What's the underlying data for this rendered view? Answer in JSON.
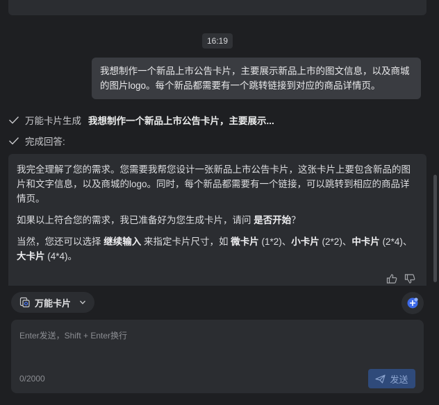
{
  "conversation": {
    "timestamp": "16:19",
    "user_message": "我想制作一个新品上市公告卡片，主要展示新品上市的图文信息，以及商城的图片logo。每个新品都需要有一个跳转链接到对应的商品详情页。",
    "steps": [
      {
        "tool": "万能卡片生成",
        "detail": "我想制作一个新品上市公告卡片，主要展示..."
      },
      {
        "tool": "完成回答:",
        "detail": ""
      }
    ],
    "answer": {
      "p1": "我完全理解了您的需求。您需要我帮您设计一张新品上市公告卡片，这张卡片上要包含新品的图片和文字信息，以及商城的logo。同时，每个新品都需要有一个链接，可以跳转到相应的商品详情页。",
      "p2_prefix": "如果以上符合您的需求，我已准备好为您生成卡片，请问 ",
      "p2_bold": "是否开始",
      "p2_suffix": "？",
      "p3_a": "当然，您还可以选择 ",
      "p3_bold1": "继续输入",
      "p3_b": " 来指定卡片尺寸，如 ",
      "p3_bold2": "微卡片",
      "p3_c": " (1*2)、",
      "p3_bold3": "小卡片",
      "p3_d": " (2*2)、",
      "p3_bold4": "中卡片",
      "p3_e": " (2*4)、",
      "p3_bold5": "大卡片",
      "p3_f": " (4*4)。"
    }
  },
  "toolbar": {
    "card_selector_label": "万能卡片"
  },
  "input": {
    "placeholder": "Enter发送，Shift + Enter换行",
    "value": "",
    "counter": "0/2000",
    "send_label": "发送"
  },
  "icons": {
    "check": "check-icon",
    "like": "thumbs-up-icon",
    "dislike": "thumbs-down-icon",
    "card": "card-stack-icon",
    "chevron": "chevron-down-icon",
    "assistant": "add-assistant-icon",
    "send": "paper-plane-icon"
  },
  "colors": {
    "background": "#1e1f22",
    "bubble": "#3a3c41",
    "panel": "#2b2d31",
    "send_button": "#2f4a7a",
    "accent": "#4d7cff"
  }
}
